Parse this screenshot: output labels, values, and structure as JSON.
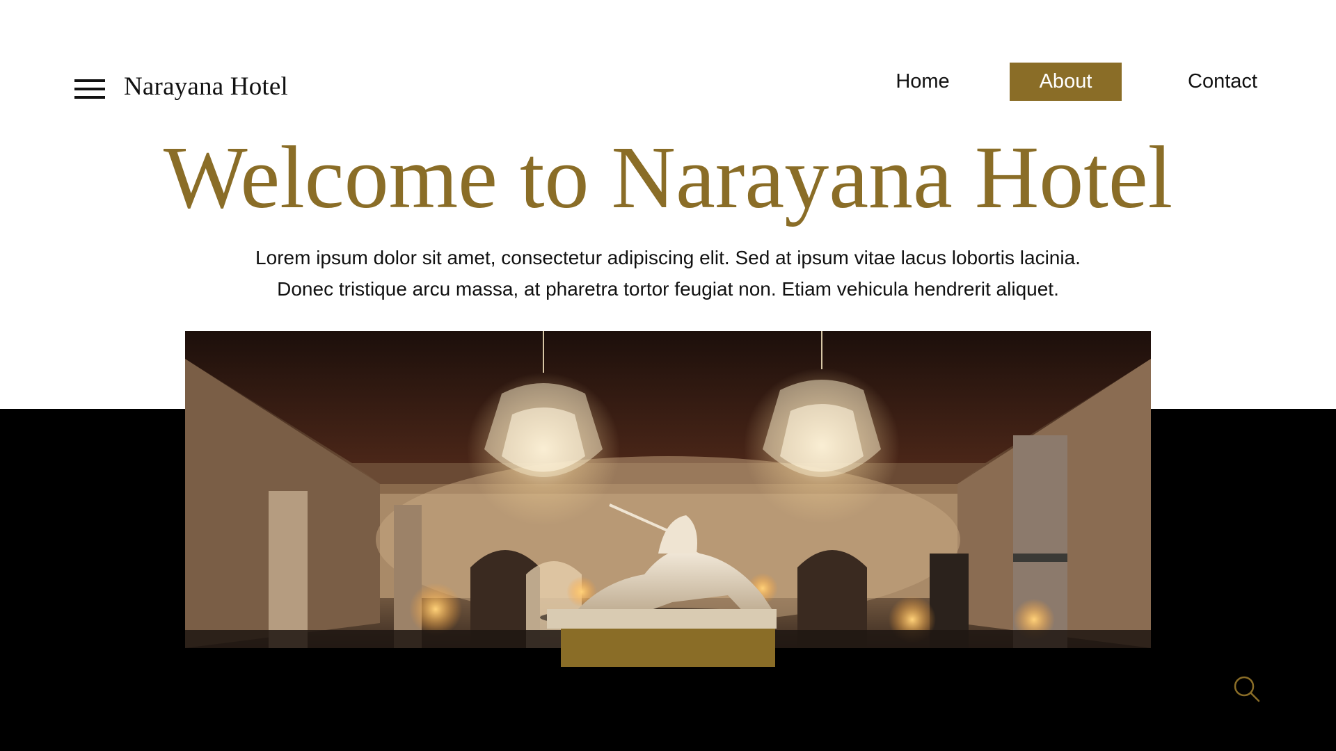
{
  "header": {
    "brand": "Narayana Hotel",
    "nav": {
      "home": "Home",
      "about": "About",
      "contact": "Contact",
      "active": "About"
    }
  },
  "hero": {
    "title": "Welcome to Narayana Hotel",
    "lines": [
      "Lorem ipsum dolor sit amet, consectetur adipiscing elit. Sed at ipsum vitae lacus lobortis lacinia.",
      "Donec tristique arcu massa, at pharetra tortor feugiat non. Etiam vehicula hendrerit aliquet."
    ]
  },
  "icons": {
    "menu": "menu-icon",
    "search": "search-icon"
  },
  "colors": {
    "accent": "#8a6d27",
    "dark": "#000000",
    "text": "#111111",
    "background": "#ffffff"
  }
}
